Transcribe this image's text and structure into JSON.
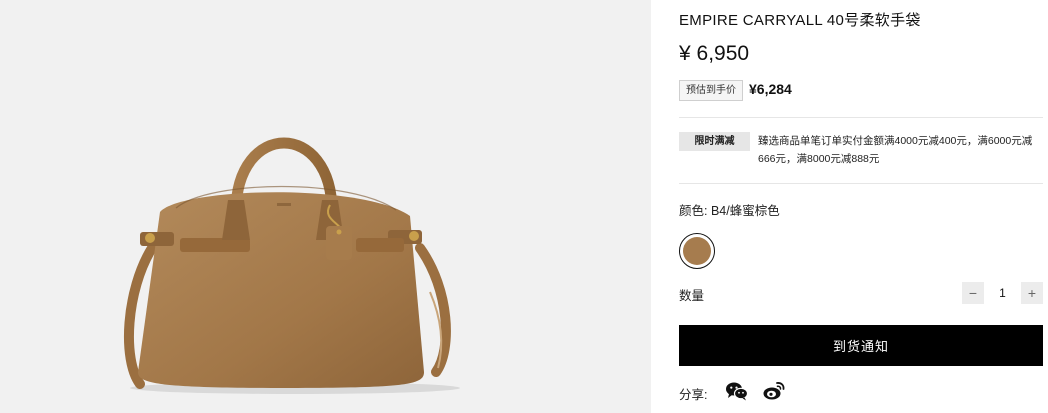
{
  "product": {
    "title": "EMPIRE CARRYALL 40号柔软手袋",
    "price": "¥ 6,950",
    "estimate_label": "预估到手价",
    "estimate_price": "¥6,284",
    "image_icon": "handbag-image"
  },
  "promotion": {
    "badge": "限时满减",
    "text": "臻选商品单笔订单实付金额满4000元减400元，满6000元减666元，满8000元减888元"
  },
  "color": {
    "label": "颜色: B4/蜂蜜棕色",
    "swatch_color": "#a67c4e"
  },
  "quantity": {
    "label": "数量",
    "minus": "−",
    "value": "1",
    "plus": "+"
  },
  "actions": {
    "notify_label": "到货通知"
  },
  "share": {
    "label": "分享:",
    "icons": [
      "wechat-icon",
      "weibo-icon"
    ]
  },
  "colors": {
    "image_background": "#f1f1f1",
    "bag_leather": "#a67c4e",
    "button_background": "#000000"
  }
}
